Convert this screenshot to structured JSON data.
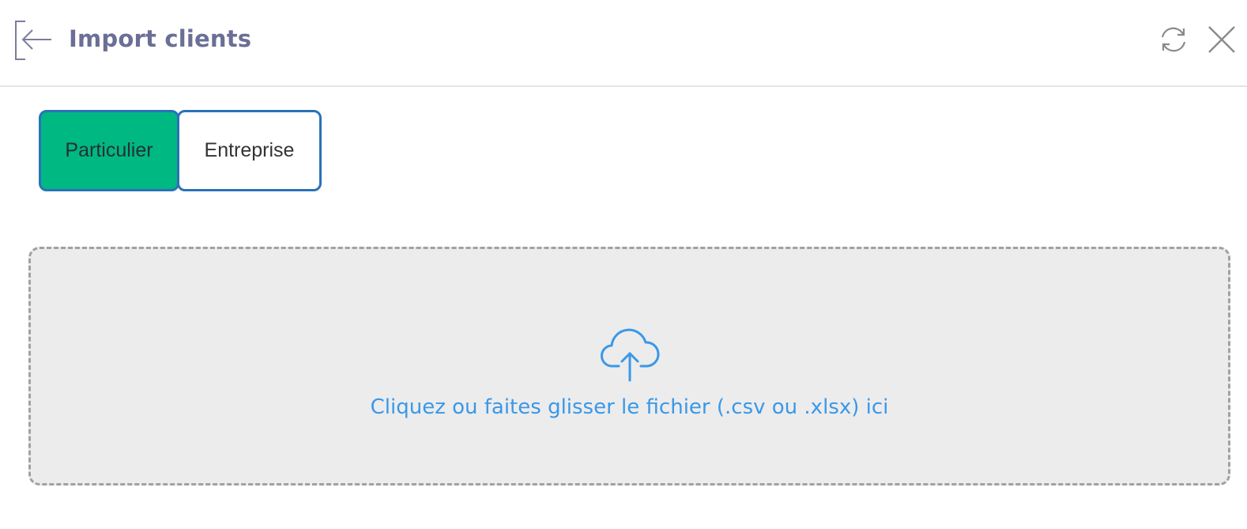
{
  "header": {
    "title": "Import clients",
    "back_icon": "back-arrow-icon",
    "refresh_icon": "refresh-icon",
    "close_icon": "close-icon"
  },
  "type_toggle": {
    "options": [
      {
        "label": "Particulier",
        "selected": true
      },
      {
        "label": "Entreprise",
        "selected": false
      }
    ]
  },
  "dropzone": {
    "icon": "cloud-upload-icon",
    "text": "Cliquez ou faites glisser le fichier (.csv ou .xlsx) ici"
  },
  "colors": {
    "accent_selected": "#00b881",
    "toggle_border": "#2b71b8",
    "title": "#6b6e96",
    "dropzone_text": "#3a98e8"
  }
}
